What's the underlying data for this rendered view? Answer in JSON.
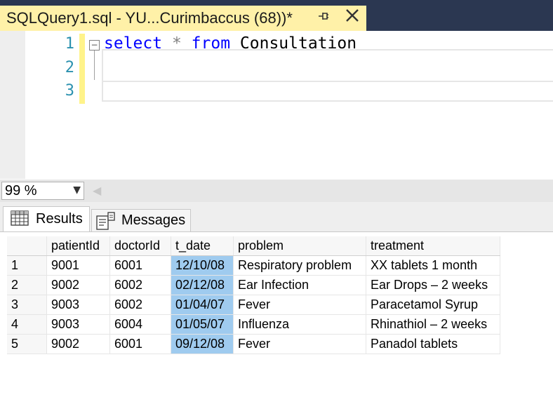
{
  "tab": {
    "title": "SQLQuery1.sql - YU...Curimbaccus (68))*",
    "pin_icon": "pin-icon",
    "close_icon": "close-icon"
  },
  "editor": {
    "line_numbers": [
      "1",
      "2",
      "3"
    ],
    "code": {
      "kw_select": "select",
      "star": "*",
      "kw_from": "from",
      "table": "Consultation"
    },
    "fold_symbol": "−"
  },
  "zoom": {
    "value": "99 %",
    "arrow": "▼"
  },
  "results_tabs": [
    {
      "label": "Results",
      "icon": "grid-icon",
      "active": true
    },
    {
      "label": "Messages",
      "icon": "messages-icon",
      "active": false
    }
  ],
  "grid": {
    "columns": [
      "patientId",
      "doctorId",
      "t_date",
      "problem",
      "treatment"
    ],
    "rows": [
      {
        "n": "1",
        "cells": [
          "9001",
          "6001",
          "12/10/08",
          "Respiratory problem",
          "XX tablets 1 month"
        ]
      },
      {
        "n": "2",
        "cells": [
          "9002",
          "6002",
          "02/12/08",
          "Ear Infection",
          "Ear Drops – 2 weeks"
        ]
      },
      {
        "n": "3",
        "cells": [
          "9003",
          "6002",
          "01/04/07",
          "Fever",
          "Paracetamol Syrup"
        ]
      },
      {
        "n": "4",
        "cells": [
          "9003",
          "6004",
          "01/05/07",
          "Influenza",
          "Rhinathiol – 2 weeks"
        ]
      },
      {
        "n": "5",
        "cells": [
          "9002",
          "6001",
          "09/12/08",
          "Fever",
          "Panadol tablets"
        ]
      }
    ],
    "selection_color": "#9fcbef"
  },
  "colors": {
    "titlebar_bg": "#2b3751",
    "tab_bg": "#fff1a8",
    "keyword": "#0000ff",
    "line_number": "#2b91af"
  }
}
